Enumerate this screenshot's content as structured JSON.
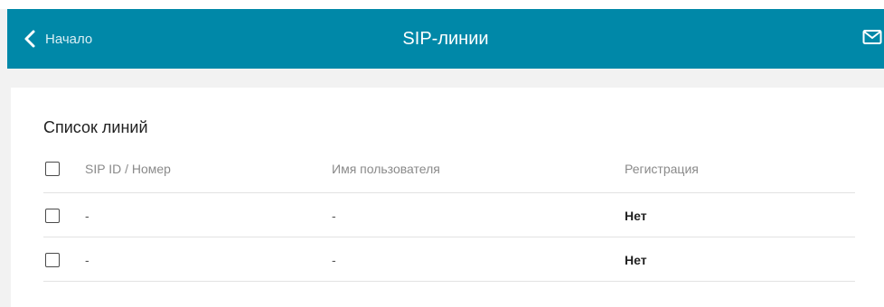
{
  "header": {
    "back_label": "Начало",
    "title": "SIP-линии",
    "back_icon": "chevron-left-icon",
    "mail_icon": "mail-icon",
    "color": "#0088a8"
  },
  "section": {
    "title": "Список линий"
  },
  "table": {
    "columns": [
      "SIP ID / Номер",
      "Имя пользователя",
      "Регистрация"
    ],
    "rows": [
      [
        "-",
        "-",
        "Нет"
      ],
      [
        "-",
        "-",
        "Нет"
      ]
    ]
  }
}
